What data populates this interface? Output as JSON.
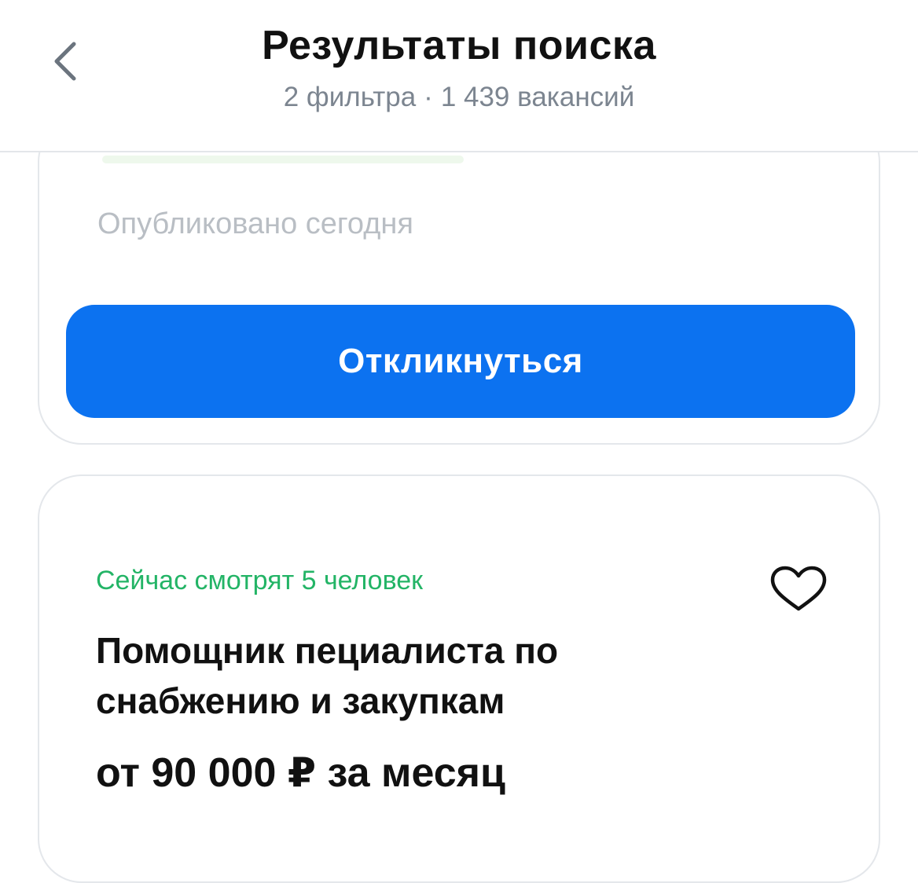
{
  "header": {
    "title": "Результаты поиска",
    "filters": "2 фильтра",
    "separator": "·",
    "count": "1 439 вакансий"
  },
  "top_card": {
    "published": "Опубликовано сегодня",
    "respond_label": "Откликнуться"
  },
  "vacancy": {
    "viewers": "Сейчас смотрят 5 человек",
    "title": "Помощник пециалиста по снабжению и закупкам",
    "salary": "от 90 000 ₽ за месяц"
  },
  "colors": {
    "accent": "#0c72f0",
    "viewers_green": "#23b466",
    "muted": "#7c8590"
  },
  "icons": {
    "back": "chevron-left-icon",
    "favorite": "heart-outline-icon"
  }
}
